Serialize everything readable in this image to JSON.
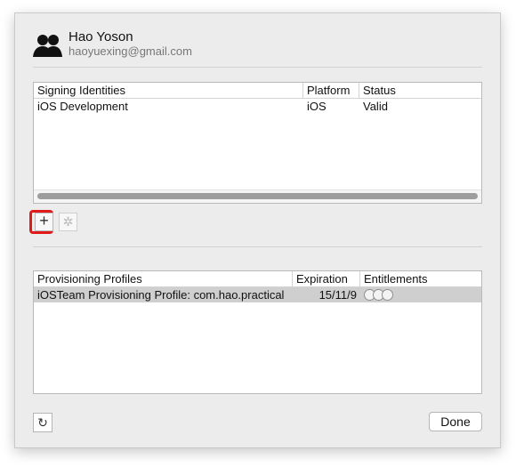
{
  "account": {
    "name": "Hao Yoson",
    "email": "haoyuexing@gmail.com",
    "avatar_icon": "users-icon"
  },
  "signing_identities": {
    "columns": [
      "Signing Identities",
      "Platform",
      "Status"
    ],
    "rows": [
      {
        "name": "iOS Development",
        "platform": "iOS",
        "status": "Valid"
      }
    ],
    "add_button": "+",
    "gear_icon": "gear-icon"
  },
  "provisioning_profiles": {
    "columns": [
      "Provisioning Profiles",
      "Expiration",
      "Entitlements"
    ],
    "rows": [
      {
        "name": "iOSTeam Provisioning Profile: com.hao.practical",
        "expiration": "15/11/9",
        "entitlements": "entitlements-icons"
      }
    ]
  },
  "footer": {
    "refresh_icon": "refresh-icon",
    "refresh_glyph": "↻",
    "done_label": "Done"
  },
  "colors": {
    "window_background": "#ececec",
    "table_border": "#b9b9b9",
    "selected_row": "#cfcfcf",
    "highlight_red": "#e01919"
  }
}
